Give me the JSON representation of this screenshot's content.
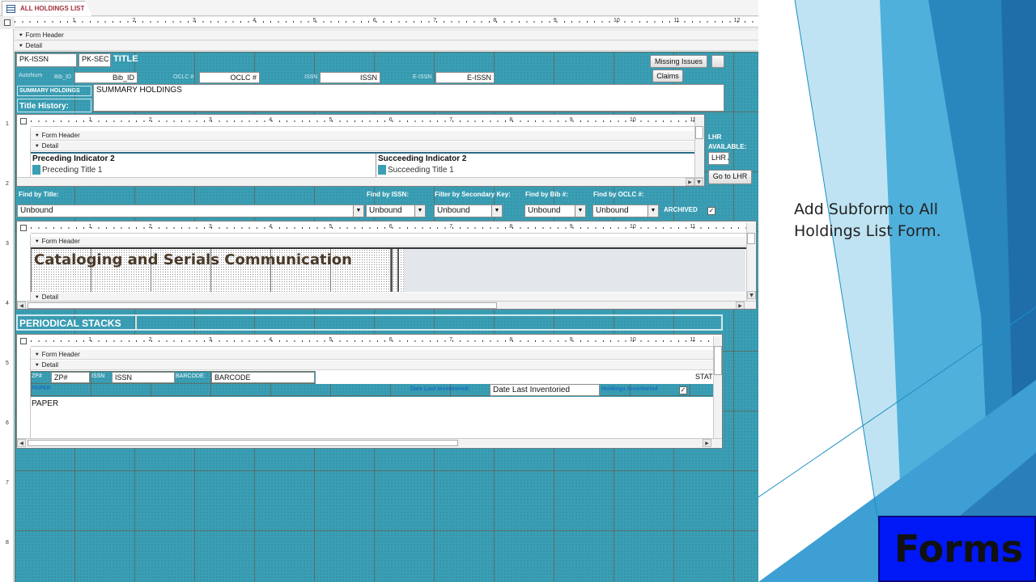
{
  "tab": {
    "title": "ALL HOLDINGS LIST"
  },
  "ruler": {
    "marks": [
      "1",
      "2",
      "3",
      "4",
      "5",
      "6",
      "7",
      "8",
      "9",
      "10",
      "11",
      "12"
    ],
    "vmarks": [
      "1",
      "2",
      "3",
      "4",
      "5",
      "6",
      "7",
      "8"
    ]
  },
  "sections": {
    "form_header": "Form Header",
    "detail": "Detail"
  },
  "main": {
    "pk_issn": "PK-ISSN",
    "pk_sec": "PK-SEC",
    "title": "TITLE",
    "missing_issues": "Missing Issues",
    "claims": "Claims",
    "autonum": "AutoNum",
    "bib_id_label": "Bib_ID",
    "bib_id": "Bib_ID",
    "oclc_label": "OCLC #",
    "oclc": "OCLC #",
    "issn_label": "ISSN",
    "issn": "ISSN",
    "eissn_label": "E-ISSN",
    "eissn": "E-ISSN",
    "summary_label": "SUMMARY HOLDINGS",
    "summary": "SUMMARY HOLDINGS",
    "title_history": "Title History:",
    "lhr_label_1": "LHR",
    "lhr_label_2": "AVAILABLE:",
    "lhr_field": "LHR A",
    "goto_lhr": "Go to LHR"
  },
  "history_sub": {
    "marks": [
      "1",
      "2",
      "3",
      "4",
      "5",
      "6",
      "7",
      "8",
      "9",
      "10",
      "11"
    ],
    "preceding_header": "Preceding Indicator 2",
    "succeeding_header": "Succeeding Indicator 2",
    "preceding_title": "Preceding Title 1",
    "succeeding_title": "Succeeding Title 1"
  },
  "find": {
    "by_title": "Find by Title:",
    "by_issn": "Find by ISSN:",
    "by_sec": "Filter by Secondary Key:",
    "by_bib": "Find by Bib #:",
    "by_oclc": "Find by OCLC #:",
    "archived": "ARCHIVED",
    "unbound": "Unbound"
  },
  "comm_sub": {
    "marks": [
      "1",
      "2",
      "3",
      "4",
      "5",
      "6",
      "7",
      "8",
      "9",
      "10",
      "11"
    ],
    "heading": "Cataloging and Serials Communication"
  },
  "periodical": {
    "label": "PERIODICAL STACKS"
  },
  "stacks_sub": {
    "marks": [
      "1",
      "2",
      "3",
      "4",
      "5",
      "6",
      "7",
      "8",
      "9",
      "10",
      "11"
    ],
    "zp_label": "ZP#",
    "zp": "ZP#",
    "issn_label": "ISSN",
    "issn": "ISSN",
    "barcode_label": "BARCODE:",
    "barcode": "BARCODE",
    "stat": "STAT",
    "paper_label": "PAPER",
    "date_inv_label": "Date Last Inventoried:",
    "date_inv": "Date Last Inventoried",
    "holdings_inv": "Holdings Inventoried",
    "paper": "PAPER"
  },
  "slide": {
    "caption": "Add Subform to All Holdings List Form.",
    "badge": "Forms"
  },
  "colors": {
    "accent": "#3a9eb4",
    "badge": "#0018f6"
  }
}
